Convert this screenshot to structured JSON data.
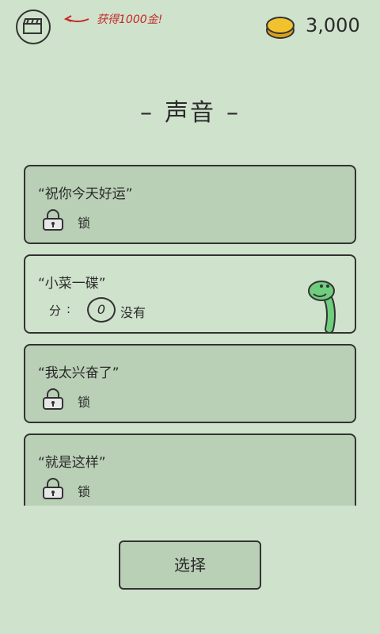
{
  "header": {
    "reward_text": "获得1000金!",
    "coin_count": "3,000"
  },
  "title": {
    "text": "声音",
    "dash_left": "–",
    "dash_right": "–"
  },
  "cards": [
    {
      "title": "“祝你今天好运”",
      "lock_label": "锁"
    },
    {
      "title": "“小菜一碟”",
      "score_label": "分",
      "score_colon": ":",
      "score_value": "0",
      "score_status": "没有"
    },
    {
      "title": "“我太兴奋了”",
      "lock_label": "锁"
    },
    {
      "title": "“就是这样”",
      "lock_label": "锁"
    }
  ],
  "footer": {
    "select_label": "选择"
  },
  "colors": {
    "background": "#cfe2cc",
    "locked_card": "#b9cfb6",
    "reward_red": "#c62828",
    "coin_gold": "#f2c12e",
    "snake_green": "#6fce7d"
  },
  "icons": [
    "clapperboard-icon",
    "arrow-left-icon",
    "coin-icon",
    "lock-icon",
    "snake-icon"
  ]
}
